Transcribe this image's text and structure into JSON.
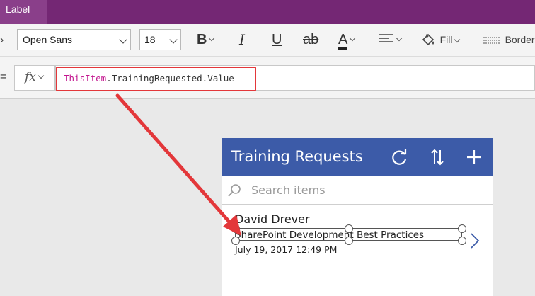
{
  "title_band": {
    "control_type": "Label"
  },
  "toolbar": {
    "font_family": "Open Sans",
    "font_size": "18",
    "bold_label": "B",
    "italic_label": "I",
    "underline_label": "U",
    "strike_label": "ab",
    "font_color_label": "A",
    "fill_label": "Fill",
    "border_label": "Border"
  },
  "formula_bar": {
    "equals": "=",
    "fx_label": "fx",
    "formula_keyword": "ThisItem",
    "formula_rest": ".TrainingRequested.Value"
  },
  "app": {
    "title": "Training Requests",
    "header_icons": [
      "refresh-icon",
      "sort-icon",
      "add-icon"
    ],
    "search_placeholder": "Search items",
    "item": {
      "title": "David Drever",
      "subtitle": "SharePoint Development Best Practices",
      "date": "July 19, 2017 12:49 PM"
    }
  },
  "colors": {
    "title_band": "#742774",
    "app_header": "#3c5ba8",
    "annotation_red": "#e3373a",
    "formula_keyword": "#c3168f"
  }
}
